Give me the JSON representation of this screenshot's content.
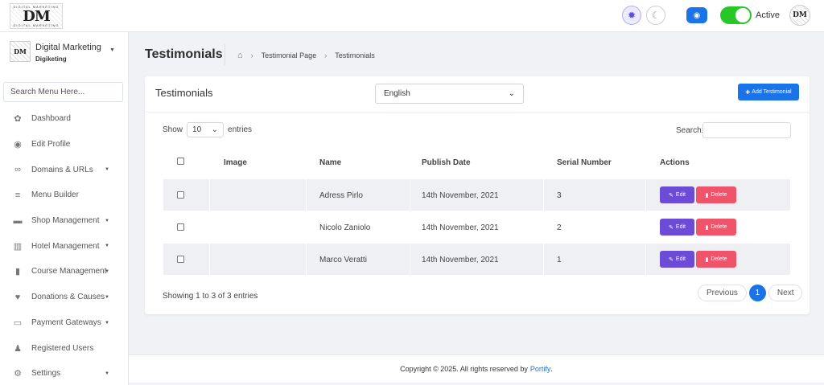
{
  "topbar": {
    "logo_text": "DM",
    "logo_caption": "DIGITAL MARKETING",
    "toggle_label": "Active",
    "avatar_text": "DM"
  },
  "sidebar": {
    "profile_name": "Digital Marketing",
    "profile_sub": "Digiketing",
    "search_placeholder": "Search Menu Here...",
    "items": [
      {
        "label": "Dashboard",
        "icon": "palette-icon",
        "glyph": "✿",
        "has_caret": false
      },
      {
        "label": "Edit Profile",
        "icon": "user-circle-icon",
        "glyph": "◉",
        "has_caret": false
      },
      {
        "label": "Domains & URLs",
        "icon": "link-icon",
        "glyph": "∞",
        "has_caret": true
      },
      {
        "label": "Menu Builder",
        "icon": "bars-icon",
        "glyph": "≡",
        "has_caret": false
      },
      {
        "label": "Shop Management",
        "icon": "store-icon",
        "glyph": "▬",
        "has_caret": true
      },
      {
        "label": "Hotel Management",
        "icon": "building-icon",
        "glyph": "▥",
        "has_caret": true
      },
      {
        "label": "Course Management",
        "icon": "book-icon",
        "glyph": "▮",
        "has_caret": true
      },
      {
        "label": "Donations & Causes",
        "icon": "hand-holding-icon",
        "glyph": "♥",
        "has_caret": true
      },
      {
        "label": "Payment Gateways",
        "icon": "credit-card-icon",
        "glyph": "▭",
        "has_caret": true
      },
      {
        "label": "Registered Users",
        "icon": "users-icon",
        "glyph": "♟",
        "has_caret": false
      },
      {
        "label": "Settings",
        "icon": "gear-icon",
        "glyph": "⚙",
        "has_caret": true
      }
    ]
  },
  "page": {
    "title": "Testimonials",
    "breadcrumb": [
      "Testimonial Page",
      "Testimonials"
    ]
  },
  "card": {
    "title": "Testimonials",
    "language": "English",
    "add_button": "Add Testimonial",
    "show_label": "Show",
    "entries_value": "10",
    "entries_label": "entries",
    "search_label": "Search:",
    "columns": [
      "Image",
      "Name",
      "Publish Date",
      "Serial Number",
      "Actions"
    ],
    "rows": [
      {
        "name": "Adress Pirlo",
        "date": "14th November, 2021",
        "serial": "3"
      },
      {
        "name": "Nicolo Zaniolo",
        "date": "14th November, 2021",
        "serial": "2"
      },
      {
        "name": "Marco Veratti",
        "date": "14th November, 2021",
        "serial": "1"
      }
    ],
    "edit_label": "Edit",
    "delete_label": "Delete",
    "info": "Showing 1 to 3 of 3 entries",
    "pager": {
      "prev": "Previous",
      "current": "1",
      "next": "Next"
    }
  },
  "footer": {
    "text": "Copyright © 2025. All rights reserved by",
    "link": "Portify",
    "suffix": "."
  },
  "colors": {
    "accent": "#1a73e8",
    "edit": "#6c4bd6",
    "delete": "#f0546b",
    "toggle": "#28c728"
  }
}
